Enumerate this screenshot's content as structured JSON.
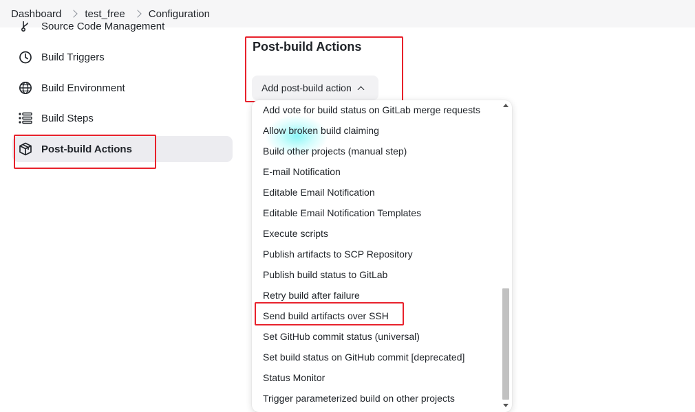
{
  "breadcrumb": {
    "items": [
      "Dashboard",
      "test_free",
      "Configuration"
    ]
  },
  "sidebar": {
    "items": [
      {
        "label": "Source Code Management",
        "icon": "branch-icon"
      },
      {
        "label": "Build Triggers",
        "icon": "clock-icon"
      },
      {
        "label": "Build Environment",
        "icon": "globe-icon"
      },
      {
        "label": "Build Steps",
        "icon": "list-icon"
      },
      {
        "label": "Post-build Actions",
        "icon": "package-icon",
        "active": true
      }
    ]
  },
  "main": {
    "section_title": "Post-build Actions",
    "add_button_label": "Add post-build action"
  },
  "dropdown": {
    "items": [
      "Add vote for build status on GitLab merge requests",
      "Allow broken build claiming",
      "Build other projects (manual step)",
      "E-mail Notification",
      "Editable Email Notification",
      "Editable Email Notification Templates",
      "Execute scripts",
      "Publish artifacts to SCP Repository",
      "Publish build status to GitLab",
      "Retry build after failure",
      "Send build artifacts over SSH",
      "Set GitHub commit status (universal)",
      "Set build status on GitHub commit [deprecated]",
      "Status Monitor",
      "Trigger parameterized build on other projects"
    ],
    "highlighted_item": "Send build artifacts over SSH"
  },
  "colors": {
    "annotation_red": "#e8212b",
    "active_bg": "#ececf0",
    "breadcrumb_bg": "#f6f6f7"
  }
}
